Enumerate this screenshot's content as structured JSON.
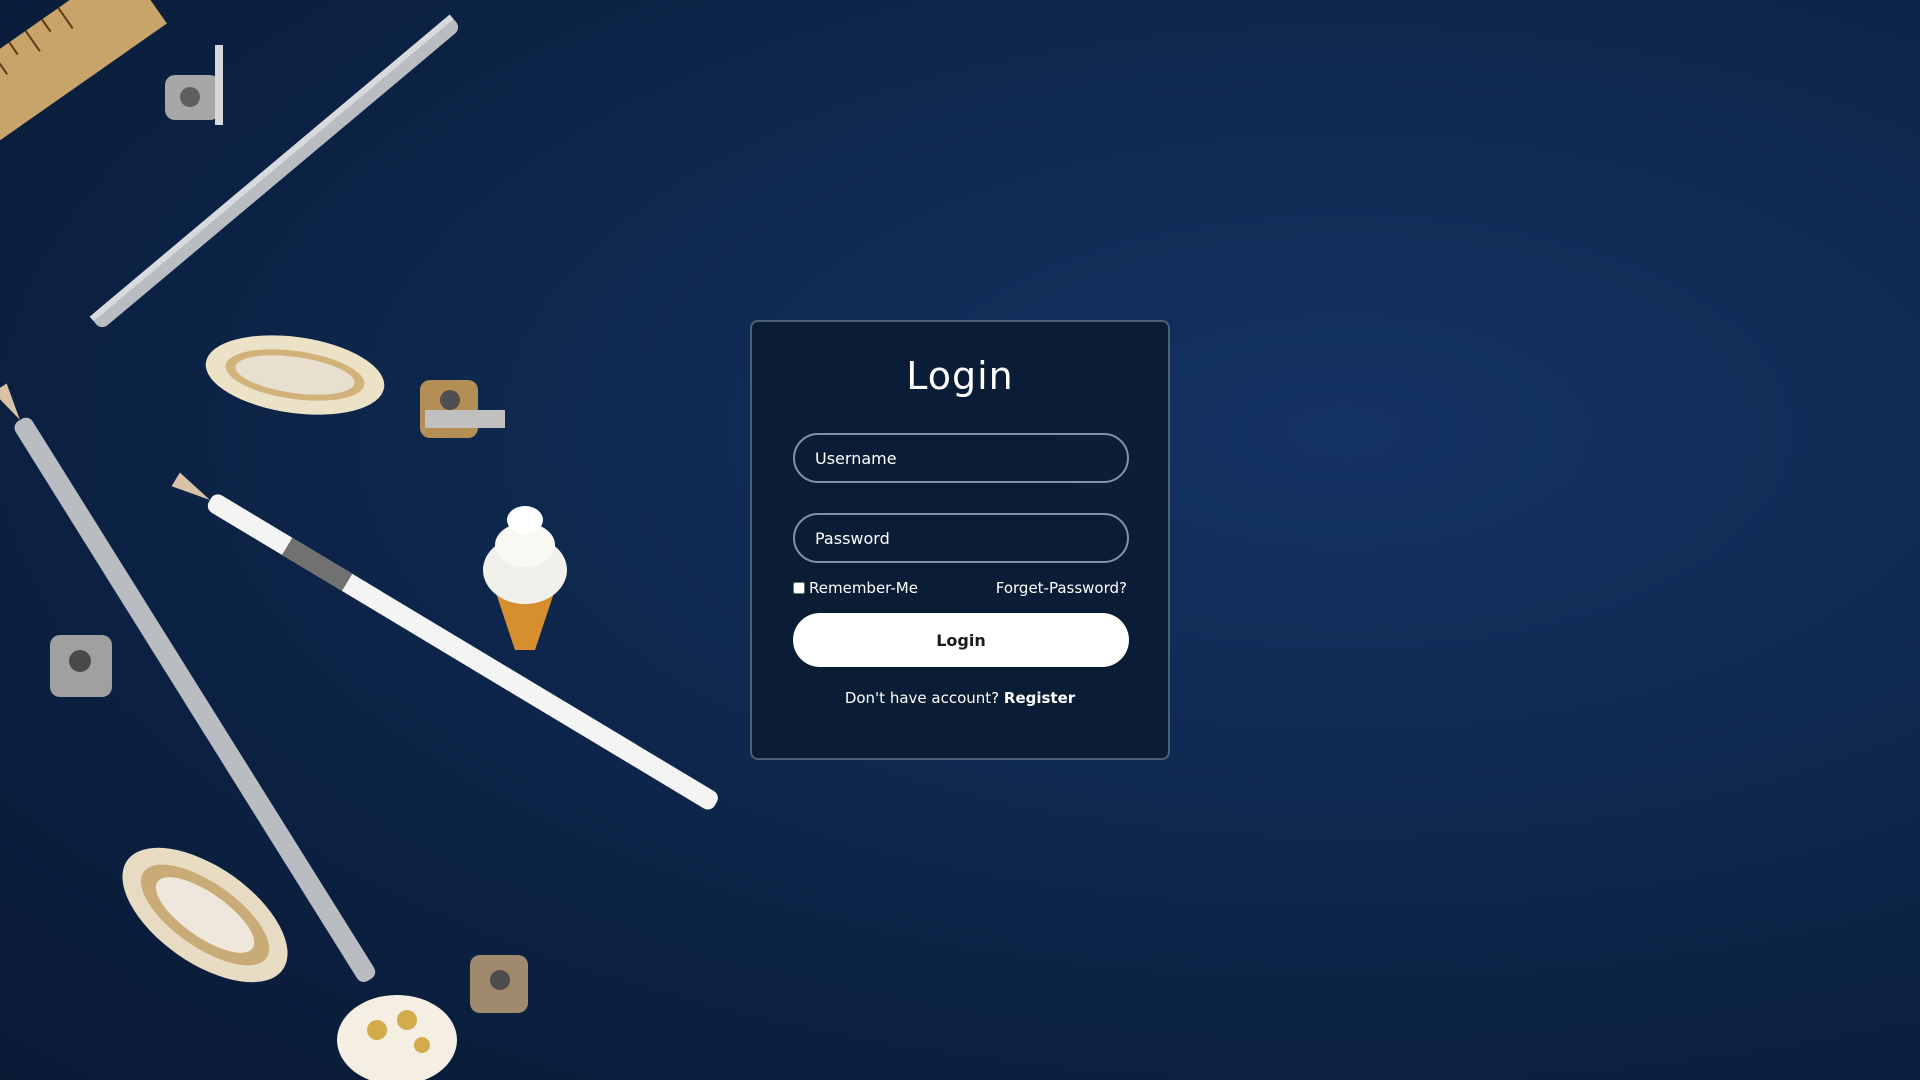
{
  "login": {
    "title": "Login",
    "username_placeholder": "Username",
    "password_placeholder": "Password",
    "remember_label": "Remember-Me",
    "forgot_label": "Forget-Password?",
    "submit_label": "Login",
    "register_prompt": "Don't have account?",
    "register_label": "Register"
  },
  "colors": {
    "background": "#0f2a52",
    "card": "#0b1a30",
    "card_border": "#4e5f78",
    "button": "#ffffff"
  }
}
